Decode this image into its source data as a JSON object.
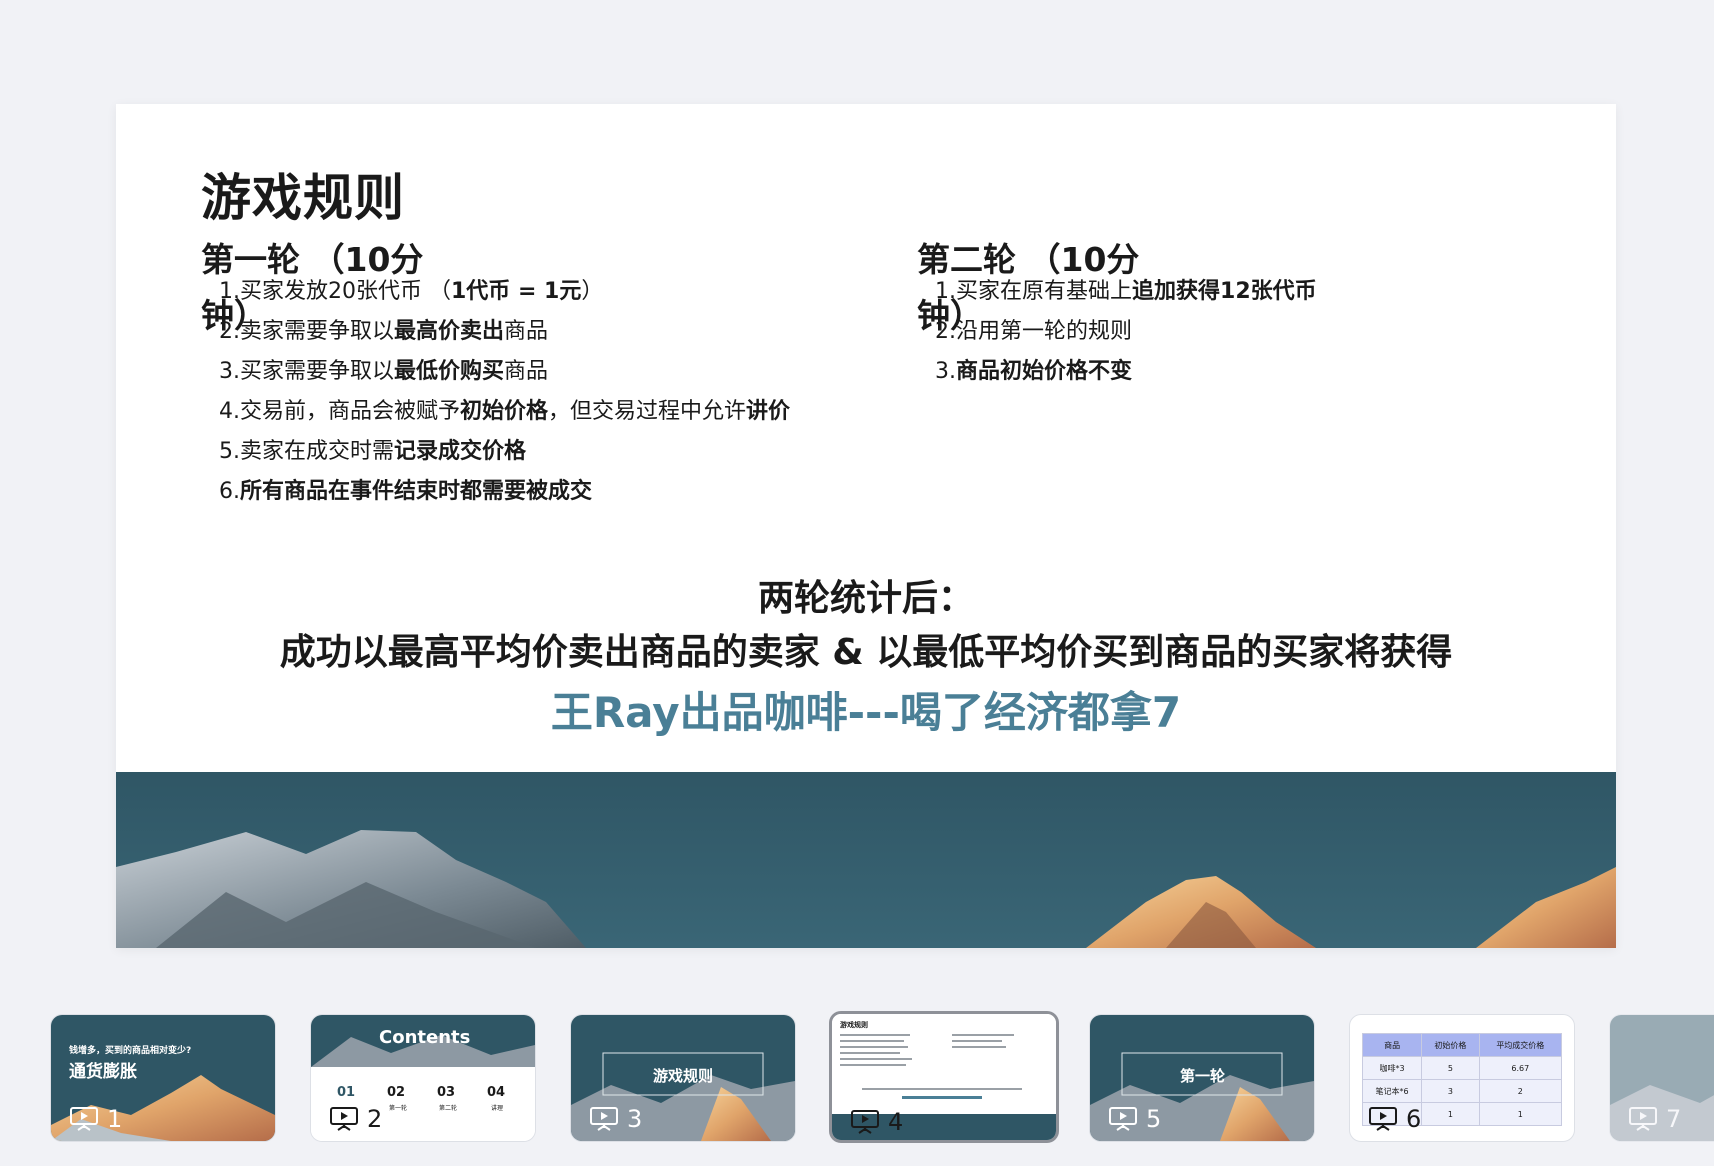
{
  "slide": {
    "title": "游戏规则",
    "round1": {
      "heading": "第一轮 （10分钟）",
      "rules": [
        {
          "parts": [
            {
              "t": "买家发放20张代币 （",
              "b": false
            },
            {
              "t": "1代币 = 1元",
              "b": true
            },
            {
              "t": "）",
              "b": false
            }
          ]
        },
        {
          "parts": [
            {
              "t": "卖家需要争取以",
              "b": false
            },
            {
              "t": "最高价卖出",
              "b": true
            },
            {
              "t": "商品",
              "b": false
            }
          ]
        },
        {
          "parts": [
            {
              "t": "买家需要争取以",
              "b": false
            },
            {
              "t": "最低价购买",
              "b": true
            },
            {
              "t": "商品",
              "b": false
            }
          ]
        },
        {
          "parts": [
            {
              "t": "交易前，商品会被赋予",
              "b": false
            },
            {
              "t": "初始价格",
              "b": true
            },
            {
              "t": "，但交易过程中允许",
              "b": false
            },
            {
              "t": "讲价",
              "b": true
            }
          ]
        },
        {
          "parts": [
            {
              "t": "卖家在成交时需",
              "b": false
            },
            {
              "t": "记录成交价格",
              "b": true
            }
          ]
        },
        {
          "parts": [
            {
              "t": "所有商品在事件结束时都需要被成交",
              "b": true
            }
          ]
        }
      ]
    },
    "round2": {
      "heading": "第二轮 （10分钟）",
      "rules": [
        {
          "parts": [
            {
              "t": "买家在原有基础上",
              "b": false
            },
            {
              "t": "追加获得12张代币",
              "b": true
            }
          ]
        },
        {
          "parts": [
            {
              "t": "沿用第一轮的规则",
              "b": false
            }
          ]
        },
        {
          "parts": [
            {
              "t": "商品初始价格不变",
              "b": true
            }
          ]
        }
      ]
    },
    "summary_line1": "两轮统计后：",
    "summary_line2": "成功以最高平均价卖出商品的卖家 & 以最低平均价买到商品的买家将获得",
    "summary_line3": "王Ray出品咖啡---喝了经济都拿7"
  },
  "colors": {
    "highlight": "#4a7f96",
    "sky": "#2f5665",
    "filmstrip_bg": "#f1f2f6"
  },
  "filmstrip": {
    "thumbnails": [
      {
        "num": "1",
        "subtitle": "钱增多，买到的商品相对变少?",
        "title": "通货膨胀"
      },
      {
        "num": "2",
        "title": "Contents",
        "items": [
          {
            "n": "01",
            "l": ""
          },
          {
            "n": "02",
            "l": "第一轮"
          },
          {
            "n": "03",
            "l": "第二轮"
          },
          {
            "n": "04",
            "l": "讲理"
          }
        ]
      },
      {
        "num": "3",
        "title": "游戏规则"
      },
      {
        "num": "4",
        "title": "游戏规则"
      },
      {
        "num": "5",
        "title": "第一轮"
      },
      {
        "num": "6",
        "table": [
          [
            "商品",
            "初始价格",
            "平均成交价格"
          ],
          [
            "咖啡*3",
            "5",
            "6.67"
          ],
          [
            "笔记本*6",
            "3",
            "2"
          ],
          [
            "",
            "1",
            "1"
          ]
        ]
      },
      {
        "num": "7"
      }
    ]
  }
}
